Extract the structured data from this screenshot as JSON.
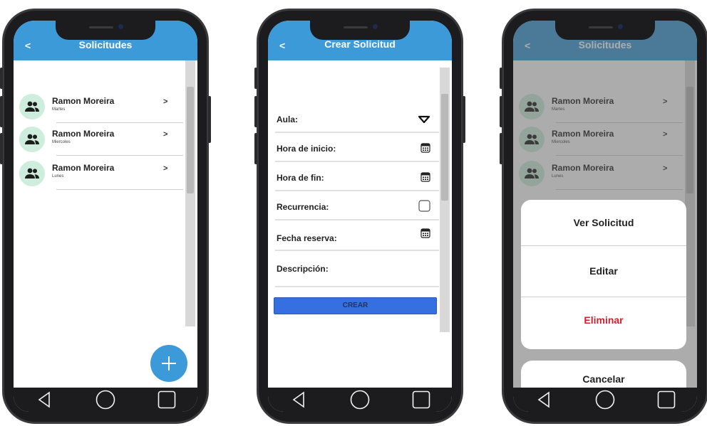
{
  "colors": {
    "appbar": "#3c9ad9",
    "fab": "#3c9ad9",
    "avatar_bg": "#cdeedd",
    "create_button": "#3670e0",
    "danger": "#d0202e"
  },
  "screen1": {
    "back_label": "<",
    "title": "Solicitudes",
    "items": [
      {
        "name": "Ramon Moreira",
        "day": "Martes",
        "arrow": ">",
        "icon": "people-icon"
      },
      {
        "name": "Ramon Moreira",
        "day": "Miercoles",
        "arrow": ">",
        "icon": "people-icon"
      },
      {
        "name": "Ramon Moreira",
        "day": "Lunes",
        "arrow": ">",
        "icon": "people-icon"
      }
    ],
    "fab_icon": "plus-icon"
  },
  "screen2": {
    "back_label": "<",
    "title": "Crear Solicitud",
    "fields": [
      {
        "label": "Aula:",
        "icon": "dropdown-triangle-icon"
      },
      {
        "label": "Hora de inicio:",
        "icon": "calendar-icon"
      },
      {
        "label": "Hora de fin:",
        "icon": "calendar-icon"
      },
      {
        "label": "Recurrencia:",
        "icon": "checkbox-icon"
      },
      {
        "label": "Fecha reserva:",
        "icon": "calendar-icon"
      },
      {
        "label": "Descripción:",
        "icon": ""
      }
    ],
    "create_label": "CREAR"
  },
  "screen3": {
    "back_label": "<",
    "title": "Solicitudes",
    "items": [
      {
        "name": "Ramon Moreira",
        "day": "Martes",
        "arrow": ">"
      },
      {
        "name": "Ramon Moreira",
        "day": "Miercoles",
        "arrow": ">"
      },
      {
        "name": "Ramon Moreira",
        "day": "Lunes",
        "arrow": ">"
      }
    ],
    "sheet": {
      "view_label": "Ver Solicitud",
      "edit_label": "Editar",
      "delete_label": "Eliminar",
      "cancel_label": "Cancelar"
    }
  },
  "navbar": {
    "back_icon": "nav-back-triangle-icon",
    "home_icon": "nav-home-circle-icon",
    "recents_icon": "nav-recents-square-icon"
  }
}
